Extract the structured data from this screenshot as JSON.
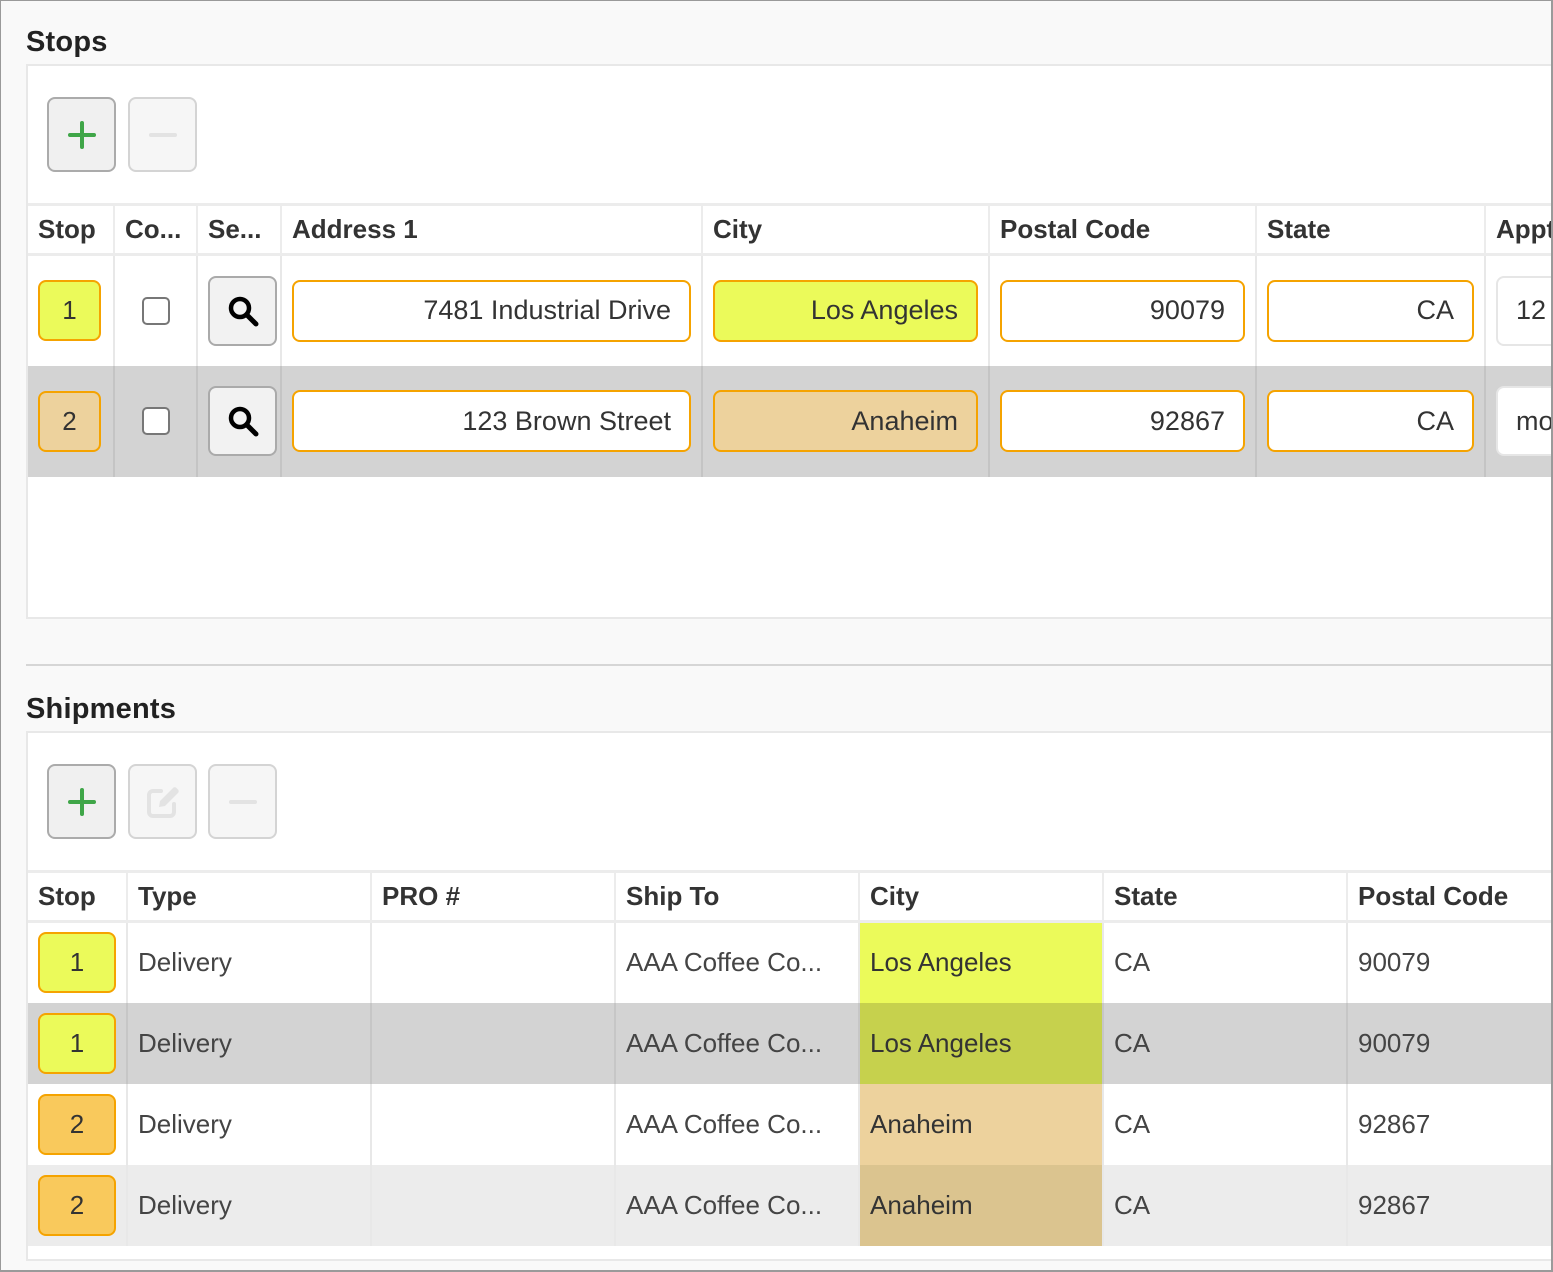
{
  "stops": {
    "title": "Stops",
    "toolbar": {
      "add_icon": "plus-icon",
      "remove_icon": "minus-icon"
    },
    "columns": [
      "Stop",
      "Co...",
      "Se...",
      "Address 1",
      "City",
      "Postal Code",
      "State",
      "Appt"
    ],
    "rows": [
      {
        "stop": "1",
        "confirmed": false,
        "address1": "7481 Industrial Drive",
        "city": "Los Angeles",
        "postal_code": "90079",
        "state": "CA",
        "appt": "12",
        "color": "#ebfa5a"
      },
      {
        "stop": "2",
        "confirmed": false,
        "address1": "123 Brown Street",
        "city": "Anaheim",
        "postal_code": "92867",
        "state": "CA",
        "appt": "mo",
        "color": "#edd29d"
      }
    ]
  },
  "shipments": {
    "title": "Shipments",
    "toolbar": {
      "add_icon": "plus-icon",
      "edit_icon": "edit-icon",
      "remove_icon": "minus-icon"
    },
    "columns": [
      "Stop",
      "Type",
      "PRO #",
      "Ship To",
      "City",
      "State",
      "Postal Code"
    ],
    "rows": [
      {
        "stop": "1",
        "type": "Delivery",
        "pro": "",
        "ship_to": "AAA Coffee Co...",
        "city": "Los Angeles",
        "state": "CA",
        "postal_code": "90079"
      },
      {
        "stop": "1",
        "type": "Delivery",
        "pro": "",
        "ship_to": "AAA Coffee Co...",
        "city": "Los Angeles",
        "state": "CA",
        "postal_code": "90079"
      },
      {
        "stop": "2",
        "type": "Delivery",
        "pro": "",
        "ship_to": "AAA Coffee Co...",
        "city": "Anaheim",
        "state": "CA",
        "postal_code": "92867"
      },
      {
        "stop": "2",
        "type": "Delivery",
        "pro": "",
        "ship_to": "AAA Coffee Co...",
        "city": "Anaheim",
        "state": "CA",
        "postal_code": "92867"
      }
    ]
  },
  "colors": {
    "stop1": "#ebfa5a",
    "stop2": "#edd29d",
    "accent_border": "#f5a300",
    "add_green": "#3fa648"
  }
}
